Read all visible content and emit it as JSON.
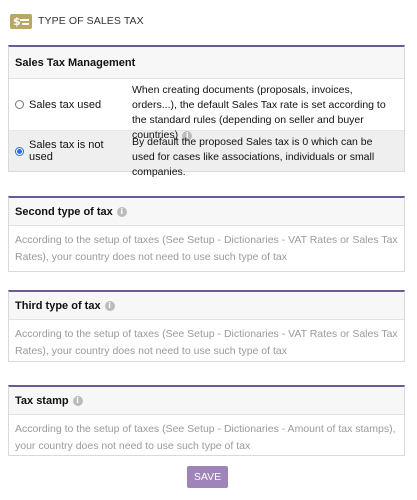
{
  "header": {
    "title": "TYPE OF SALES TAX",
    "icon": "sales-tax-icon"
  },
  "mgmt": {
    "title": "Sales Tax Management",
    "options": [
      {
        "label": "Sales tax used",
        "description": "When creating documents (proposals, invoices, orders...), the default Sales Tax rate is set according to the standard rules (depending on seller and buyer countries)",
        "selected": false
      },
      {
        "label": "Sales tax is not used",
        "description": "By default the proposed Sales tax is 0 which can be used for cases like associations, individuals or small companies.",
        "selected": true
      }
    ]
  },
  "second": {
    "title": "Second type of tax",
    "text": "According to the setup of taxes (See Setup - Dictionaries - VAT Rates or Sales Tax Rates), your country does not need to use such type of tax"
  },
  "third": {
    "title": "Third type of tax",
    "text": "According to the setup of taxes (See Setup - Dictionaries - VAT Rates or Sales Tax Rates), your country does not need to use such type of tax"
  },
  "stamp": {
    "title": "Tax stamp",
    "text": "According to the setup of taxes (See Setup - Dictionaries - Amount of tax stamps), your country does not need to use such type of tax"
  },
  "save_label": "SAVE",
  "colors": {
    "accent": "#6b5b95",
    "save_button": "#9e84b8",
    "header_icon": "#b9a85f"
  }
}
